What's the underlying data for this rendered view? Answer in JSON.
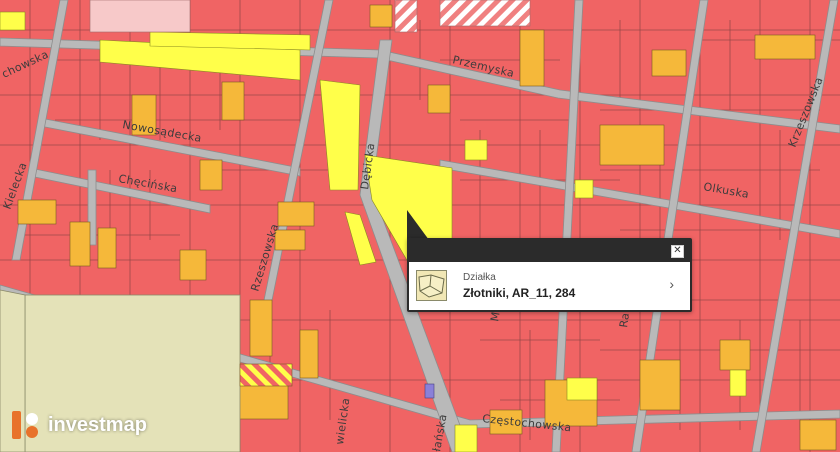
{
  "streets": {
    "kozlowska_partial": "chowska",
    "nowosadecka": "Nowosądecka",
    "checinska": "Chęcińska",
    "kielecka": "Kielecka",
    "rzeszowska": "Rzeszowska",
    "debicka": "Dębicka",
    "przemyska": "Przemyska",
    "krzeszowska": "Krzeszowska",
    "olkuska": "Olkuska",
    "czestochowska": "Częstochowska",
    "wielicka_partial": "wielicka",
    "lanska_partial": "łańska",
    "m_partial": "M",
    "ra_partial": "Ra"
  },
  "popup": {
    "type_label": "Działka",
    "parcel_id": "Złotniki, AR_11, 284",
    "close_glyph": "✕",
    "arrow_glyph": "›"
  },
  "brand": {
    "name": "investmap",
    "colors": {
      "orange": "#e8722a",
      "text": "#ffffff"
    }
  },
  "legend_colors": {
    "built_parcel": "#f06464",
    "commercial": "#f5b83a",
    "green_area": "#ffff4a",
    "road": "#b9b9b9",
    "special": "#e4e2b8",
    "pink": "#f7c9c9"
  }
}
